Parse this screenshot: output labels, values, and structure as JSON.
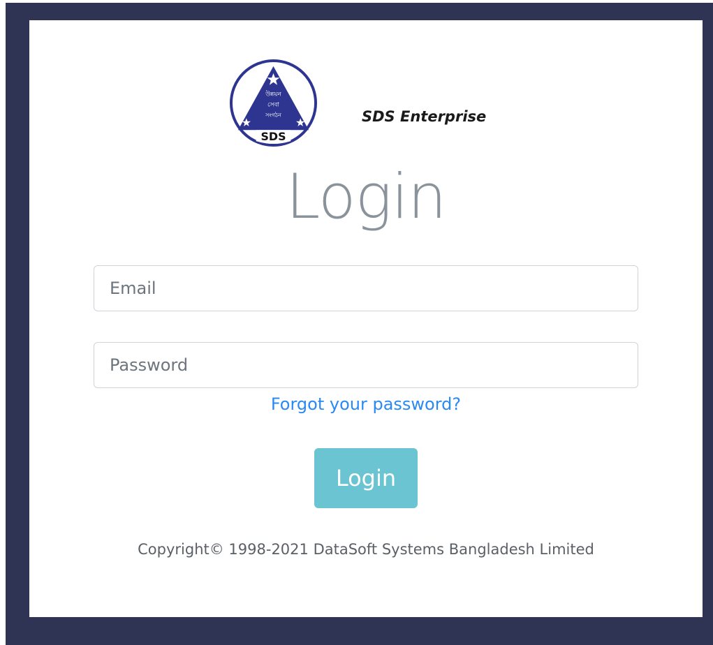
{
  "brand": {
    "name": "SDS Enterprise",
    "logo_icon": "sds-triangle-logo",
    "logo_text": "SDS",
    "logo_bangla_lines": [
      "উন্নয়ন",
      "সেবা",
      "সংগঠন"
    ]
  },
  "login_form": {
    "title": "Login",
    "email_placeholder": "Email",
    "email_value": "",
    "password_placeholder": "Password",
    "password_value": "",
    "forgot_password_label": "Forgot your password?",
    "submit_label": "Login"
  },
  "footer": {
    "copyright": "Copyright© 1998-2021 DataSoft Systems Bangladesh Limited"
  },
  "colors": {
    "backdrop": "#303454",
    "card": "#ffffff",
    "title": "#8a939c",
    "link": "#2a89f2",
    "button": "#6bc4d2",
    "logo_navy": "#2e3590"
  }
}
